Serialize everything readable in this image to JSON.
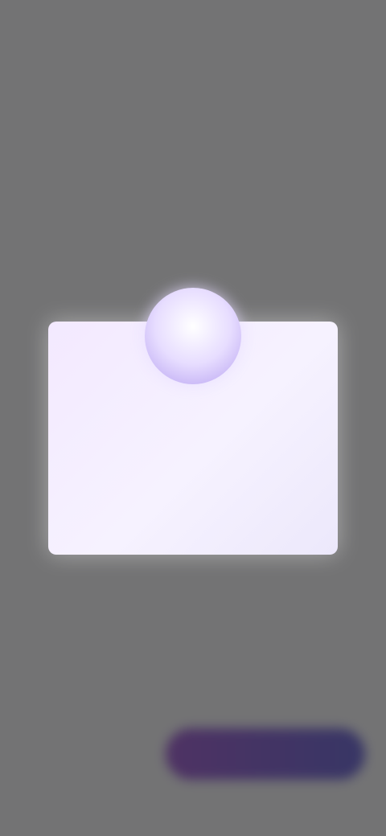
{
  "status_bar": {
    "time": ""
  },
  "page": {
    "title": "",
    "rows": [
      [
        "",
        ""
      ],
      [
        "",
        ""
      ],
      [
        "",
        ""
      ],
      [
        "",
        ""
      ]
    ],
    "cta_label": ""
  },
  "modal": {
    "title": "",
    "body": "",
    "icon": "circle-badge-icon"
  },
  "colors": {
    "scrim": "#2d2d2d",
    "modal_background": "#f4ecff",
    "accent": "#6f52c7",
    "button_start": "#8a3cc4",
    "button_end": "#4a46c8"
  }
}
